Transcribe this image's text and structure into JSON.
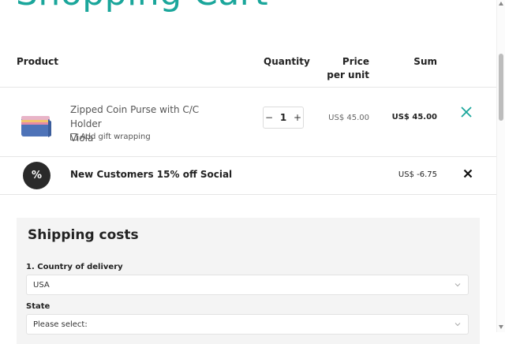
{
  "page": {
    "title": "Shopping Cart"
  },
  "cart": {
    "headers": {
      "product": "Product",
      "quantity": "Quantity",
      "price_per_unit": "Price per unit",
      "sum": "Sum"
    },
    "item": {
      "name_line1": "Zipped Coin Purse with C/C Holder",
      "name_line2": "Viola",
      "gift_wrapping_label": "Add gift wrapping",
      "gift_wrapping_checked": false,
      "quantity": "1",
      "qty_decrease": "−",
      "qty_increase": "+",
      "unit_price": "US$ 45.00",
      "sum": "US$ 45.00",
      "remove_icon": "close-icon"
    },
    "discount": {
      "badge": "%",
      "label": "New Customers 15% off Social",
      "sum": "US$ -6.75",
      "remove_icon": "close-icon"
    }
  },
  "shipping": {
    "title": "Shipping costs",
    "country_label": "1. Country of delivery",
    "country_value": "USA",
    "state_label": "State",
    "state_value": "Please select:"
  },
  "colors": {
    "accent": "#1aa69b",
    "dark": "#2a2a2a",
    "panel": "#f4f4f4"
  }
}
